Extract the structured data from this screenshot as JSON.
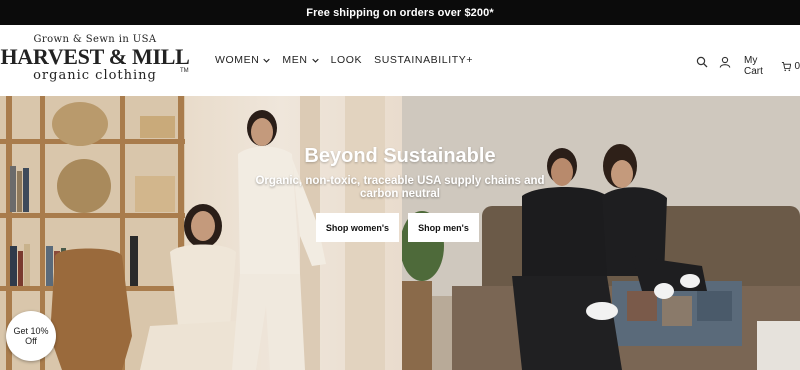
{
  "announcement": {
    "text": "Free shipping on orders over $200*"
  },
  "logo": {
    "tagline": "Grown & Sewn in USA",
    "name": "HARVEST & MILL",
    "subline": "organic clothing",
    "trademark": "TM"
  },
  "nav": {
    "items": [
      {
        "label": "WOMEN",
        "has_dropdown": true
      },
      {
        "label": "MEN",
        "has_dropdown": true
      },
      {
        "label": "LOOK",
        "has_dropdown": false
      },
      {
        "label": "SUSTAINABILITY+",
        "has_dropdown": false
      }
    ]
  },
  "header_actions": {
    "search_icon": "search-icon",
    "account_icon": "user-icon",
    "cart_label": "My Cart",
    "cart_count": "0"
  },
  "hero": {
    "title": "Beyond Sustainable",
    "subtitle": "Organic, non-toxic, traceable USA supply chains and carbon neutral",
    "buttons": {
      "women": "Shop women's",
      "men": "Shop men's"
    }
  },
  "promo_badge": {
    "line1": "Get 10%",
    "line2": "Off"
  },
  "colors": {
    "announcement_bg": "#0b0b0b",
    "text": "#222222"
  }
}
